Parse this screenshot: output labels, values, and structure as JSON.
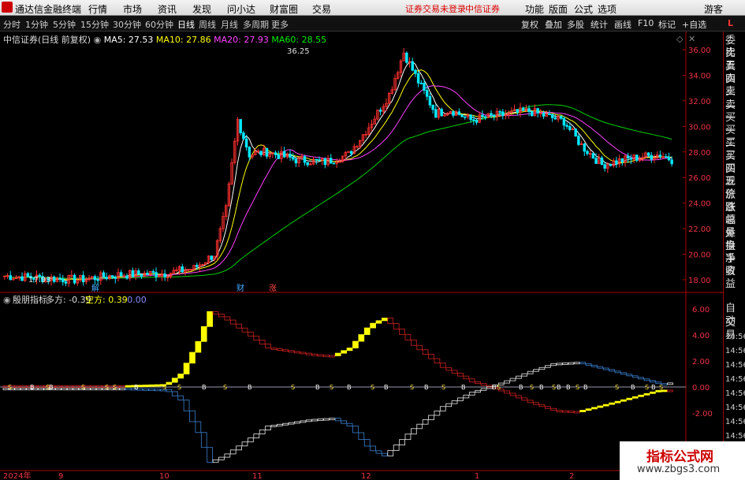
{
  "topbar": {
    "app_name": "通达信金融终端",
    "menus": [
      "行情",
      "市场",
      "资讯",
      "发现",
      "问小达",
      "财富圈",
      "交易"
    ],
    "warning": "证券交易未登录",
    "broker": "中信证券",
    "right_menus": [
      "功能",
      "版面",
      "公式",
      "选项"
    ],
    "guest": "游客"
  },
  "toolbar": {
    "periods": [
      "分时",
      "1分钟",
      "5分钟",
      "15分钟",
      "30分钟",
      "60分钟",
      "日线",
      "周线",
      "月线",
      "多周期",
      "更多"
    ],
    "active_period": "日线",
    "right_buttons": [
      "复权",
      "叠加",
      "多股",
      "统计",
      "画线",
      "F10",
      "标记",
      "+自选"
    ],
    "corner_label": "L"
  },
  "main_chart": {
    "stock_name": "中信证券",
    "title_suffix": "(日线 前复权)",
    "ma_labels": [
      {
        "text": "MA5: 27.53",
        "color": "#ffffff"
      },
      {
        "text": "MA10: 27.86",
        "color": "#ffff00"
      },
      {
        "text": "MA20: 27.93",
        "color": "#ff40ff"
      },
      {
        "text": "MA60: 28.55",
        "color": "#00e000"
      }
    ],
    "high_label": "36.25",
    "low_label": "17.93",
    "markers": [
      "财",
      "涨",
      "解"
    ],
    "y_ticks": [
      "36.00",
      "34.00",
      "32.00",
      "30.00",
      "28.00",
      "26.00",
      "24.00",
      "22.00",
      "20.00",
      "18.00"
    ]
  },
  "indicator": {
    "name": "殷朋指标",
    "duo_label": "多方: -0.39",
    "kong_label": "空方: 0.39",
    "zero_label": ": 0.00",
    "y_ticks": [
      "6.00",
      "4.00",
      "2.00",
      "0.00",
      "-2.00"
    ],
    "signal_letters": [
      "S",
      "B"
    ]
  },
  "x_axis": {
    "labels": [
      "2024年",
      "9",
      "10",
      "11",
      "12",
      "1",
      "2"
    ]
  },
  "side_panel": {
    "items": [
      "委比",
      "卖五",
      "卖四",
      "卖三",
      "卖二",
      "卖一",
      "买一",
      "买二",
      "买三",
      "买四",
      "买五",
      "现价",
      "涨跌",
      "涨幅",
      "总量",
      "外盘",
      "换手",
      "净资",
      "收益"
    ],
    "bottom_items": [
      "自动",
      "交易",
      "14:56",
      "14:56",
      "14:56",
      "14:56",
      "14:56",
      "14:56",
      "14:56",
      "14:56"
    ]
  },
  "watermark": {
    "title": "指标公式网",
    "url": "www.zbgs3.com"
  },
  "colors": {
    "up": "#ff3030",
    "down": "#00e8ff",
    "ma5": "#ffffff",
    "ma10": "#ffff00",
    "ma20": "#ff40ff",
    "ma60": "#00d000",
    "axis_red": "#c01010"
  }
}
